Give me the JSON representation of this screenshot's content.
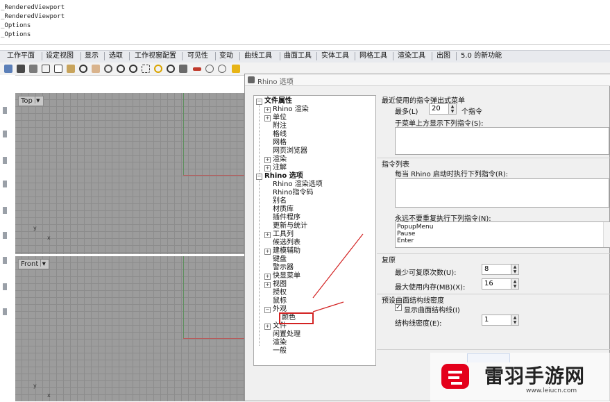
{
  "command_history": [
    "_RenderedViewport",
    "_RenderedViewport",
    "_Options",
    "_Options"
  ],
  "tabs": [
    "工作平面",
    "设定视图",
    "显示",
    "选取",
    "工作视窗配置",
    "可见性",
    "变动",
    "曲线工具",
    "曲面工具",
    "实体工具",
    "网格工具",
    "渲染工具",
    "出图",
    "5.0 的新功能"
  ],
  "toolbar": {
    "icons": [
      "new-icon",
      "save-icon",
      "print-icon",
      "open-icon",
      "cut-icon",
      "copy-icon",
      "paste-icon",
      "undo-icon",
      "pan-icon",
      "rotate-icon",
      "zoom-icon",
      "zoom-window-icon",
      "zoom-extents-icon",
      "zoom-selected-icon",
      "rotate-view-icon",
      "named-view-icon",
      "grid-icon",
      "lights-icon",
      "shade-icon",
      "render-icon",
      "render-sphere-icon",
      "color-wheel-icon",
      "material-icon",
      "sphere-icon",
      "properties-icon",
      "options-icon",
      "help-icon"
    ],
    "colors": {
      "accent_red": "#c0392b",
      "accent_blue": "#2e5aa8",
      "accent_yellow": "#e7b416"
    }
  },
  "viewports": {
    "top": {
      "label": "Top"
    },
    "front": {
      "label": "Front"
    },
    "axis_x": "x",
    "axis_y": "y"
  },
  "dialog": {
    "title": "Rhino 选项",
    "tree": {
      "doc_root": "文件属性",
      "doc_items": [
        "Rhino 渲染",
        "单位",
        "附注",
        "格线",
        "网格",
        "网页浏览器",
        "渲染",
        "注解"
      ],
      "rhino_root": "Rhino 选项",
      "rhino_items": [
        "Rhino 渲染选项",
        "Rhino指令码",
        "别名",
        "材质库",
        "插件程序",
        "更新与统计",
        "工具列",
        "候选列表",
        "建模辅助",
        "键盘",
        "警示器",
        "快显菜单",
        "视图",
        "授权",
        "鼠标",
        "外观",
        "颜色",
        "文件",
        "闲置处理",
        "渲染",
        "一般"
      ]
    },
    "recent_commands": {
      "section_title": "最近使用的指令弹出式菜单",
      "max_label": "最多(L)",
      "max_value": "20",
      "max_unit": "个指令",
      "top_list_label": "于菜单上方显示下列指令(S):"
    },
    "command_list": {
      "section_title": "指令列表",
      "startup_label": "每当 Rhino 启动时执行下列指令(R):",
      "never_repeat_label": "永远不要重复执行下列指令(N):",
      "never_repeat_items": [
        "PopupMenu",
        "Pause",
        "Enter"
      ]
    },
    "undo": {
      "section_title": "复原",
      "min_steps_label": "最少可复原次数(U):",
      "min_steps_value": "8",
      "max_memory_label": "最大使用内存(MB)(X):",
      "max_memory_value": "16"
    },
    "isocurve": {
      "section_title": "预设曲面结构线密度",
      "show_label": "显示曲面结构线(I)",
      "show_checked": true,
      "density_label": "结构线密度(E):",
      "density_value": "1"
    }
  },
  "watermark": {
    "brand": "雷羽手游网",
    "url": "www.leiucn.com"
  }
}
